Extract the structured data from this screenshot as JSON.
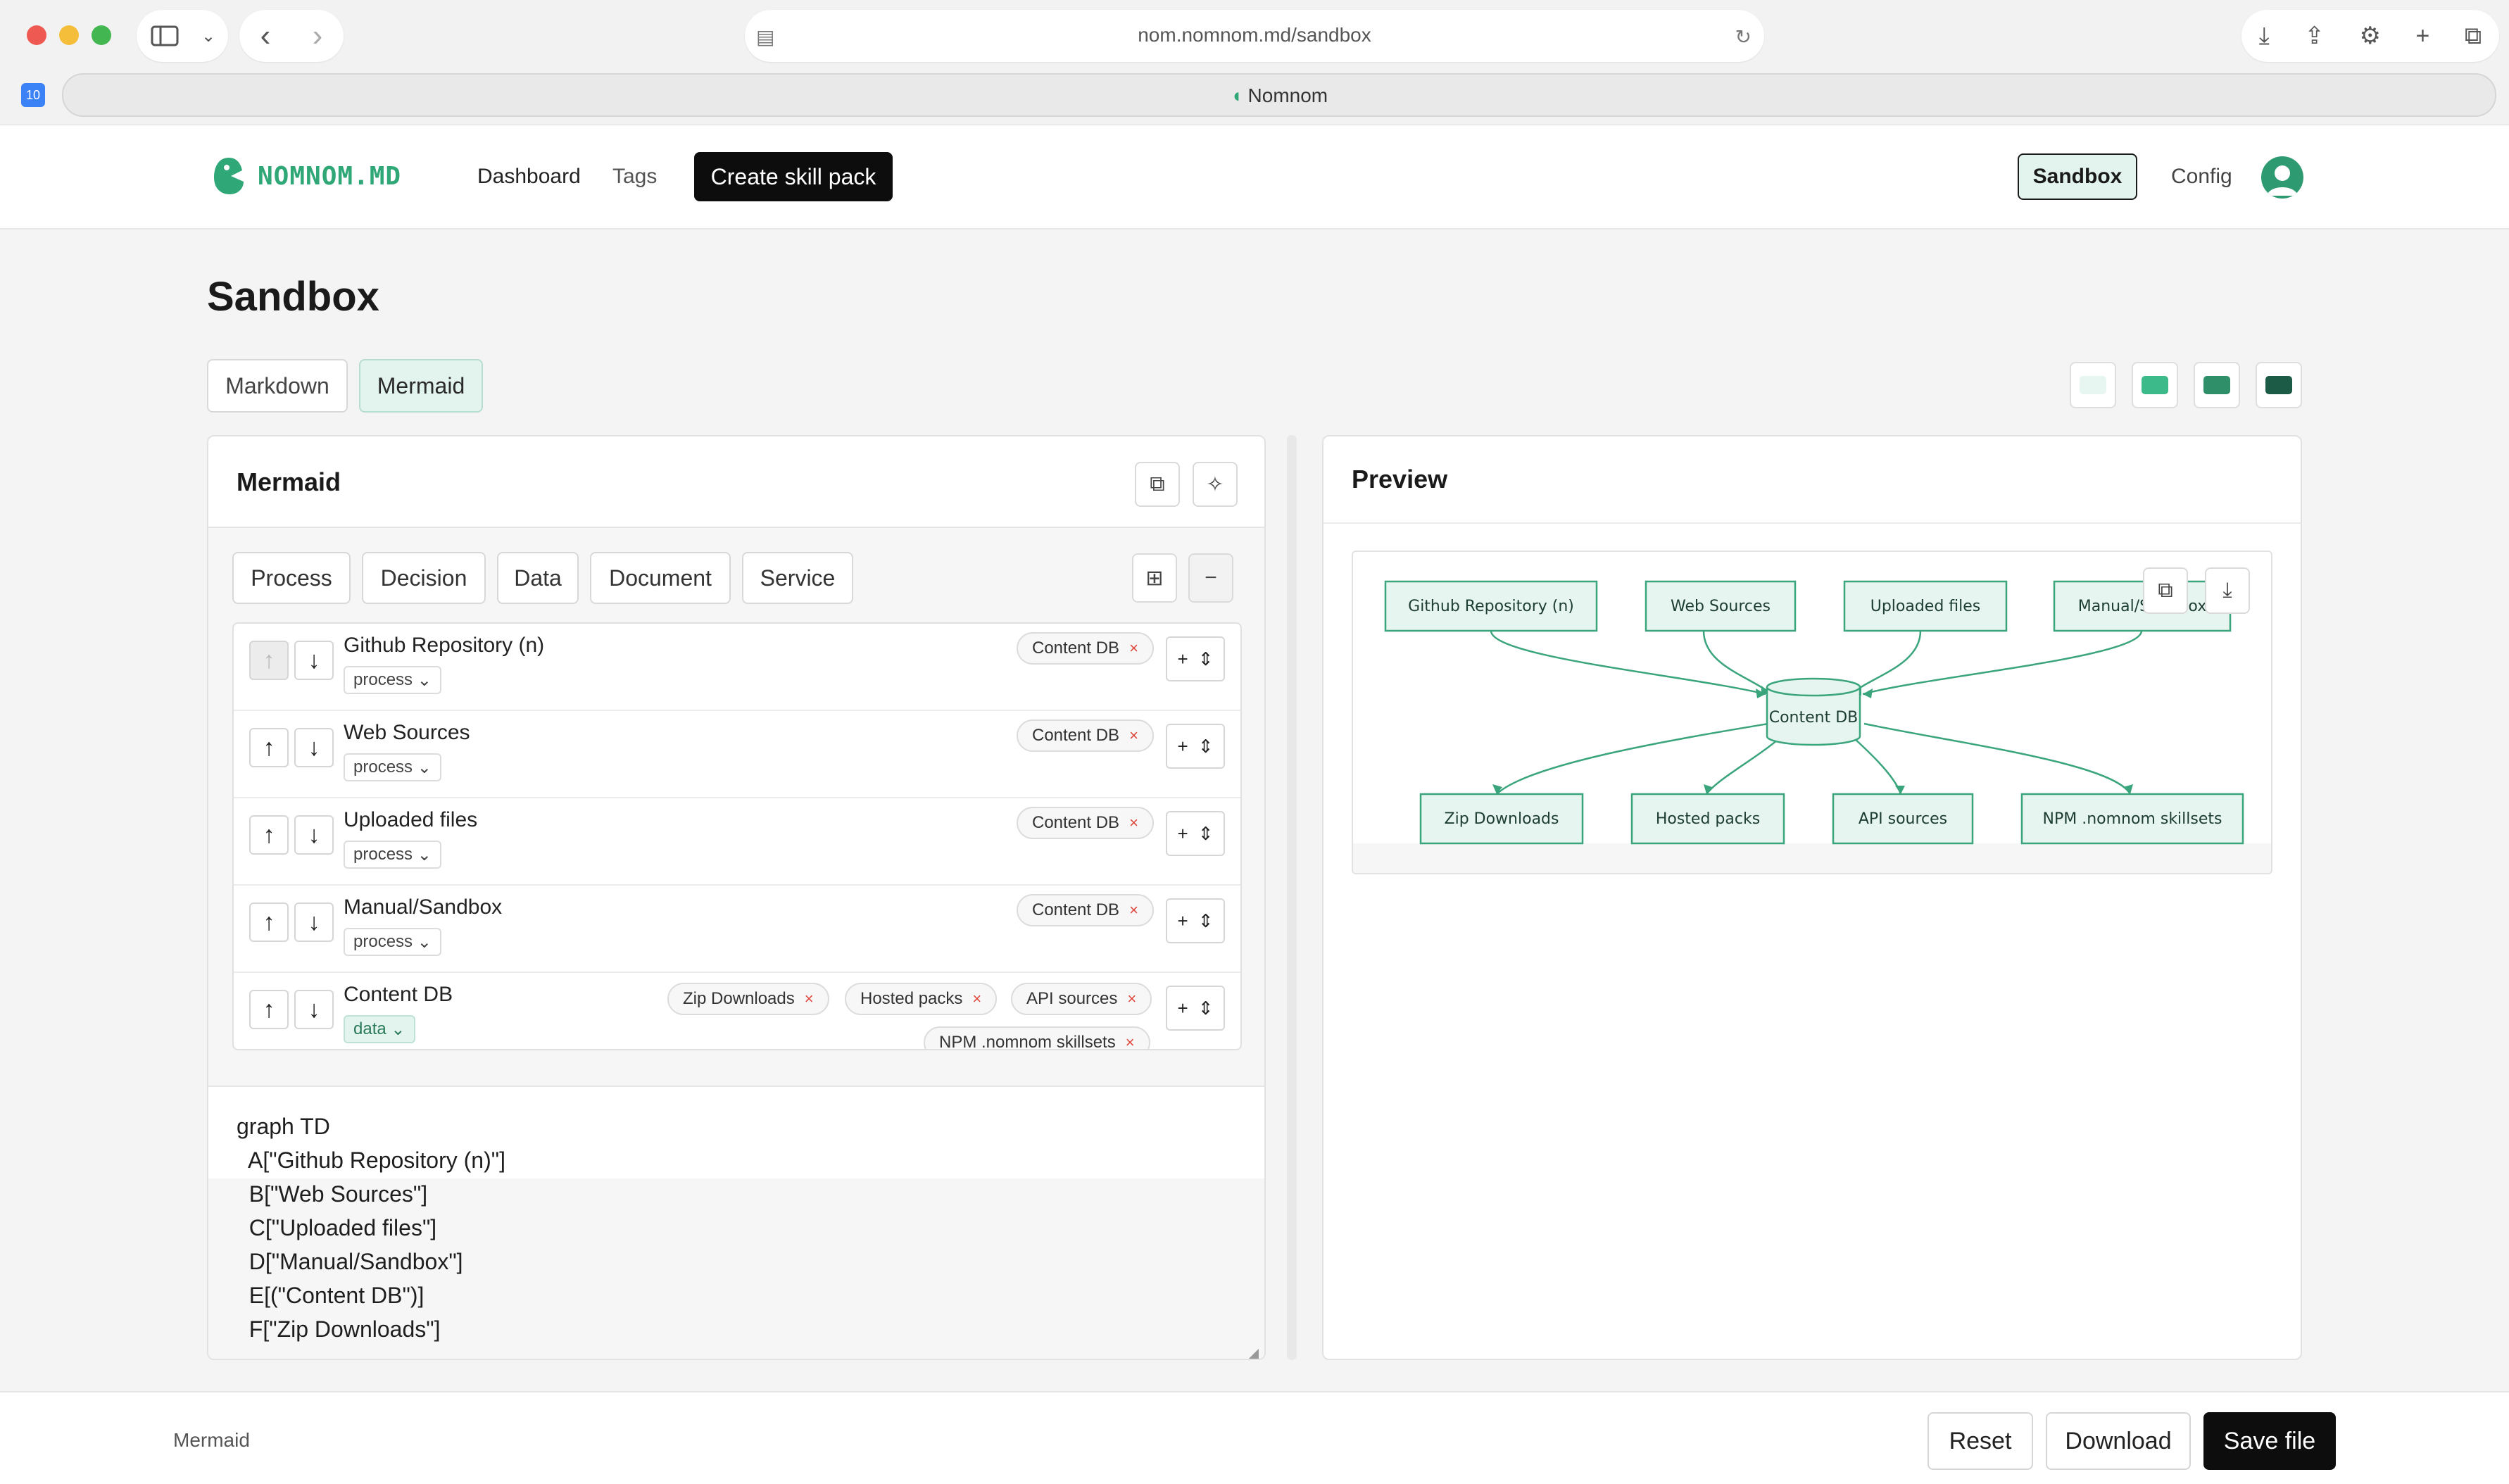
{
  "browser": {
    "url_host": "nom.nomnom.md",
    "url_path": "/sandbox",
    "tab_title": "Nomnom",
    "tab_badge": "10"
  },
  "header": {
    "logo_text": "NOMNOM.MD",
    "nav": {
      "dashboard": "Dashboard",
      "tags": "Tags"
    },
    "create_label": "Create skill pack",
    "sandbox_label": "Sandbox",
    "config_label": "Config"
  },
  "page": {
    "title": "Sandbox",
    "modes": [
      "Markdown",
      "Mermaid"
    ],
    "active_mode": "Mermaid",
    "theme_swatches": [
      "#e8f6f1",
      "#3dba8a",
      "#2e8f68",
      "#1c5b45"
    ]
  },
  "editor": {
    "title": "Mermaid",
    "shapes": [
      "Process",
      "Decision",
      "Data",
      "Document",
      "Service"
    ],
    "nodes": [
      {
        "name": "Github Repository (n)",
        "type": "process",
        "targets": [
          "Content DB"
        ]
      },
      {
        "name": "Web Sources",
        "type": "process",
        "targets": [
          "Content DB"
        ]
      },
      {
        "name": "Uploaded files",
        "type": "process",
        "targets": [
          "Content DB"
        ]
      },
      {
        "name": "Manual/Sandbox",
        "type": "process",
        "targets": [
          "Content DB"
        ]
      },
      {
        "name": "Content DB",
        "type": "data",
        "targets": [
          "Zip Downloads",
          "Hosted packs",
          "API sources",
          "NPM .nomnom skillsets"
        ]
      }
    ],
    "code_lines": [
      "graph TD",
      "  A[\"Github Repository (n)\"]",
      "  B[\"Web Sources\"]",
      "  C[\"Uploaded files\"]",
      "  D[\"Manual/Sandbox\"]",
      "  E[(\"Content DB\")]",
      "  F[\"Zip Downloads\"]"
    ]
  },
  "preview": {
    "title": "Preview",
    "top_nodes": [
      "Github Repository (n)",
      "Web Sources",
      "Uploaded files",
      "Manual/Sandbox"
    ],
    "center_node": "Content DB",
    "bottom_nodes": [
      "Zip Downloads",
      "Hosted packs",
      "API sources",
      "NPM .nomnom skillsets"
    ]
  },
  "footer": {
    "label": "Mermaid",
    "reset": "Reset",
    "download": "Download",
    "save": "Save file"
  },
  "colors": {
    "accent": "#2fa777",
    "diagram_fill": "#e6f5ef",
    "diagram_stroke": "#3aa57c"
  }
}
